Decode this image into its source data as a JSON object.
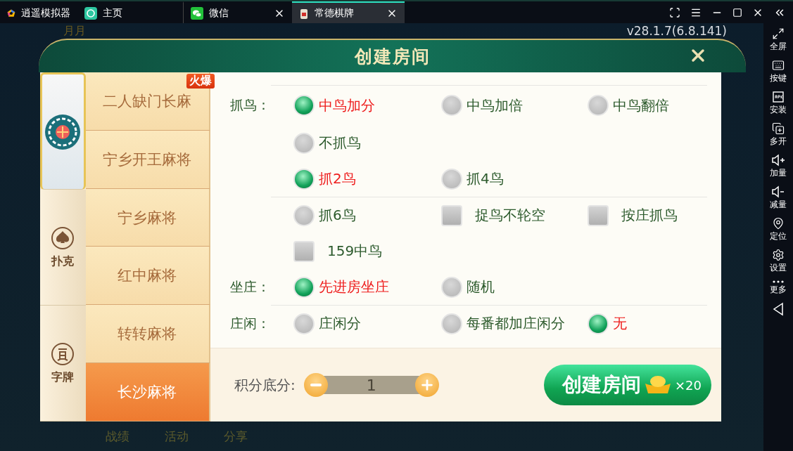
{
  "titlebar": {
    "tabs": [
      {
        "kind": "brand",
        "label": "逍遥模拟器",
        "selected": false
      },
      {
        "kind": "home",
        "label": "主页",
        "selected": false
      },
      {
        "kind": "chat",
        "label": "微信",
        "selected": false
      },
      {
        "kind": "app",
        "label": "常德棋牌",
        "selected": true
      }
    ]
  },
  "sidebar": [
    {
      "kind": "fullscreen",
      "label": "全屏"
    },
    {
      "kind": "keyboard",
      "label": "按键"
    },
    {
      "kind": "apk",
      "label": "安装"
    },
    {
      "kind": "multi",
      "label": "多开"
    },
    {
      "kind": "volup",
      "label": "加量"
    },
    {
      "kind": "voldown",
      "label": "减量"
    },
    {
      "kind": "location",
      "label": "定位"
    },
    {
      "kind": "settings",
      "label": "设置"
    },
    {
      "kind": "more",
      "label": "更多"
    },
    {
      "kind": "back"
    }
  ],
  "background": {
    "username": "月月",
    "version": "v28.1.7(6.8.141)",
    "nav": [
      "战绩",
      "活动",
      "分享"
    ]
  },
  "dialog": {
    "title": "创建房间",
    "categories": [
      {
        "kind": "mahjong",
        "selected": true
      },
      {
        "kind": "poker",
        "label": "扑克",
        "selected": false
      },
      {
        "kind": "word",
        "label": "字牌",
        "selected": false
      }
    ],
    "games": [
      {
        "label": "二人缺门长麻",
        "badge": "火爆",
        "selected": false
      },
      {
        "label": "宁乡开王麻将",
        "selected": false
      },
      {
        "label": "宁乡麻将",
        "selected": false
      },
      {
        "label": "红中麻将",
        "selected": false
      },
      {
        "label": "转转麻将",
        "selected": false
      },
      {
        "label": "长沙麻将",
        "selected": true
      }
    ],
    "groups": [
      {
        "rows": [
          {
            "label": "抓鸟：",
            "options": [
              {
                "kind": "radio",
                "label": "中鸟加分",
                "selected": true
              },
              {
                "kind": "radio",
                "label": "中鸟加倍",
                "selected": false
              },
              {
                "kind": "radio",
                "label": "中鸟翻倍",
                "selected": false
              }
            ]
          },
          {
            "options": [
              {
                "kind": "radio",
                "label": "不抓鸟",
                "selected": false
              }
            ]
          },
          {
            "options": [
              {
                "kind": "radio",
                "label": "抓2鸟",
                "selected": true
              },
              {
                "kind": "radio",
                "label": "抓4鸟",
                "selected": false
              }
            ]
          }
        ]
      },
      {
        "rows": [
          {
            "options": [
              {
                "kind": "radio",
                "label": "抓6鸟",
                "selected": false
              },
              {
                "kind": "checkbox",
                "label": "捉鸟不轮空",
                "checked": false
              },
              {
                "kind": "checkbox",
                "label": "按庄抓鸟",
                "checked": false
              }
            ]
          },
          {
            "options": [
              {
                "kind": "checkbox",
                "label": "159中鸟",
                "checked": false
              }
            ]
          },
          {
            "label": "坐庄：",
            "options": [
              {
                "kind": "radio",
                "label": "先进房坐庄",
                "selected": true
              },
              {
                "kind": "radio",
                "label": "随机",
                "selected": false
              }
            ]
          }
        ]
      },
      {
        "rows": [
          {
            "label": "庄闲：",
            "options": [
              {
                "kind": "radio",
                "label": "庄闲分",
                "selected": false
              },
              {
                "kind": "radio",
                "label": "每番都加庄闲分",
                "selected": false
              },
              {
                "kind": "radio",
                "label": "无",
                "selected": true
              }
            ]
          }
        ]
      }
    ],
    "score": {
      "label": "积分底分:",
      "value": "1"
    },
    "create": {
      "label": "创建房间",
      "cost": "×20"
    }
  }
}
